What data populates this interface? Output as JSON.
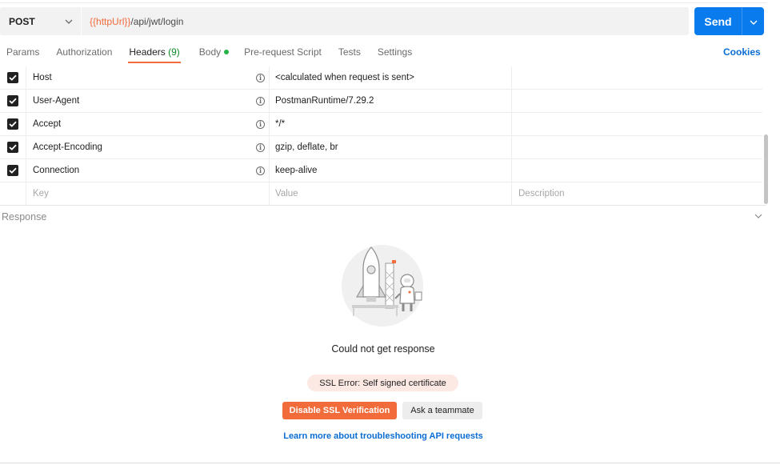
{
  "request": {
    "method": "POST",
    "url_variable": "{{httpUrl}}",
    "url_path": "/api/jwt/login",
    "send_label": "Send"
  },
  "tabs": [
    {
      "label": "Params",
      "active": false
    },
    {
      "label": "Authorization",
      "active": false
    },
    {
      "label": "Headers",
      "count": "(9)",
      "active": true
    },
    {
      "label": "Body",
      "indicator": "green-dot",
      "active": false
    },
    {
      "label": "Pre-request Script",
      "active": false
    },
    {
      "label": "Tests",
      "active": false
    },
    {
      "label": "Settings",
      "active": false
    }
  ],
  "cookies_label": "Cookies",
  "headers": {
    "rows": [
      {
        "key": "Host",
        "value": "<calculated when request is sent>",
        "description": "",
        "checked": true
      },
      {
        "key": "User-Agent",
        "value": "PostmanRuntime/7.29.2",
        "description": "",
        "checked": true
      },
      {
        "key": "Accept",
        "value": "*/*",
        "description": "",
        "checked": true
      },
      {
        "key": "Accept-Encoding",
        "value": "gzip, deflate, br",
        "description": "",
        "checked": true
      },
      {
        "key": "Connection",
        "value": "keep-alive",
        "description": "",
        "checked": true
      }
    ],
    "placeholder": {
      "key": "Key",
      "value": "Value",
      "description": "Description"
    }
  },
  "response": {
    "title": "Response",
    "message": "Could not get response",
    "error": "SSL Error: Self signed certificate",
    "disable_ssl_label": "Disable SSL Verification",
    "ask_teammate_label": "Ask a teammate",
    "learn_more_label": "Learn more about troubleshooting API requests"
  },
  "colors": {
    "accent": "#f26b3a",
    "primary": "#097bed",
    "link": "#0a6dd4",
    "success": "#26b247"
  },
  "icons": [
    "chevron-down-icon",
    "checkbox-checked-icon",
    "info-icon",
    "rocket-astronaut-illustration"
  ]
}
